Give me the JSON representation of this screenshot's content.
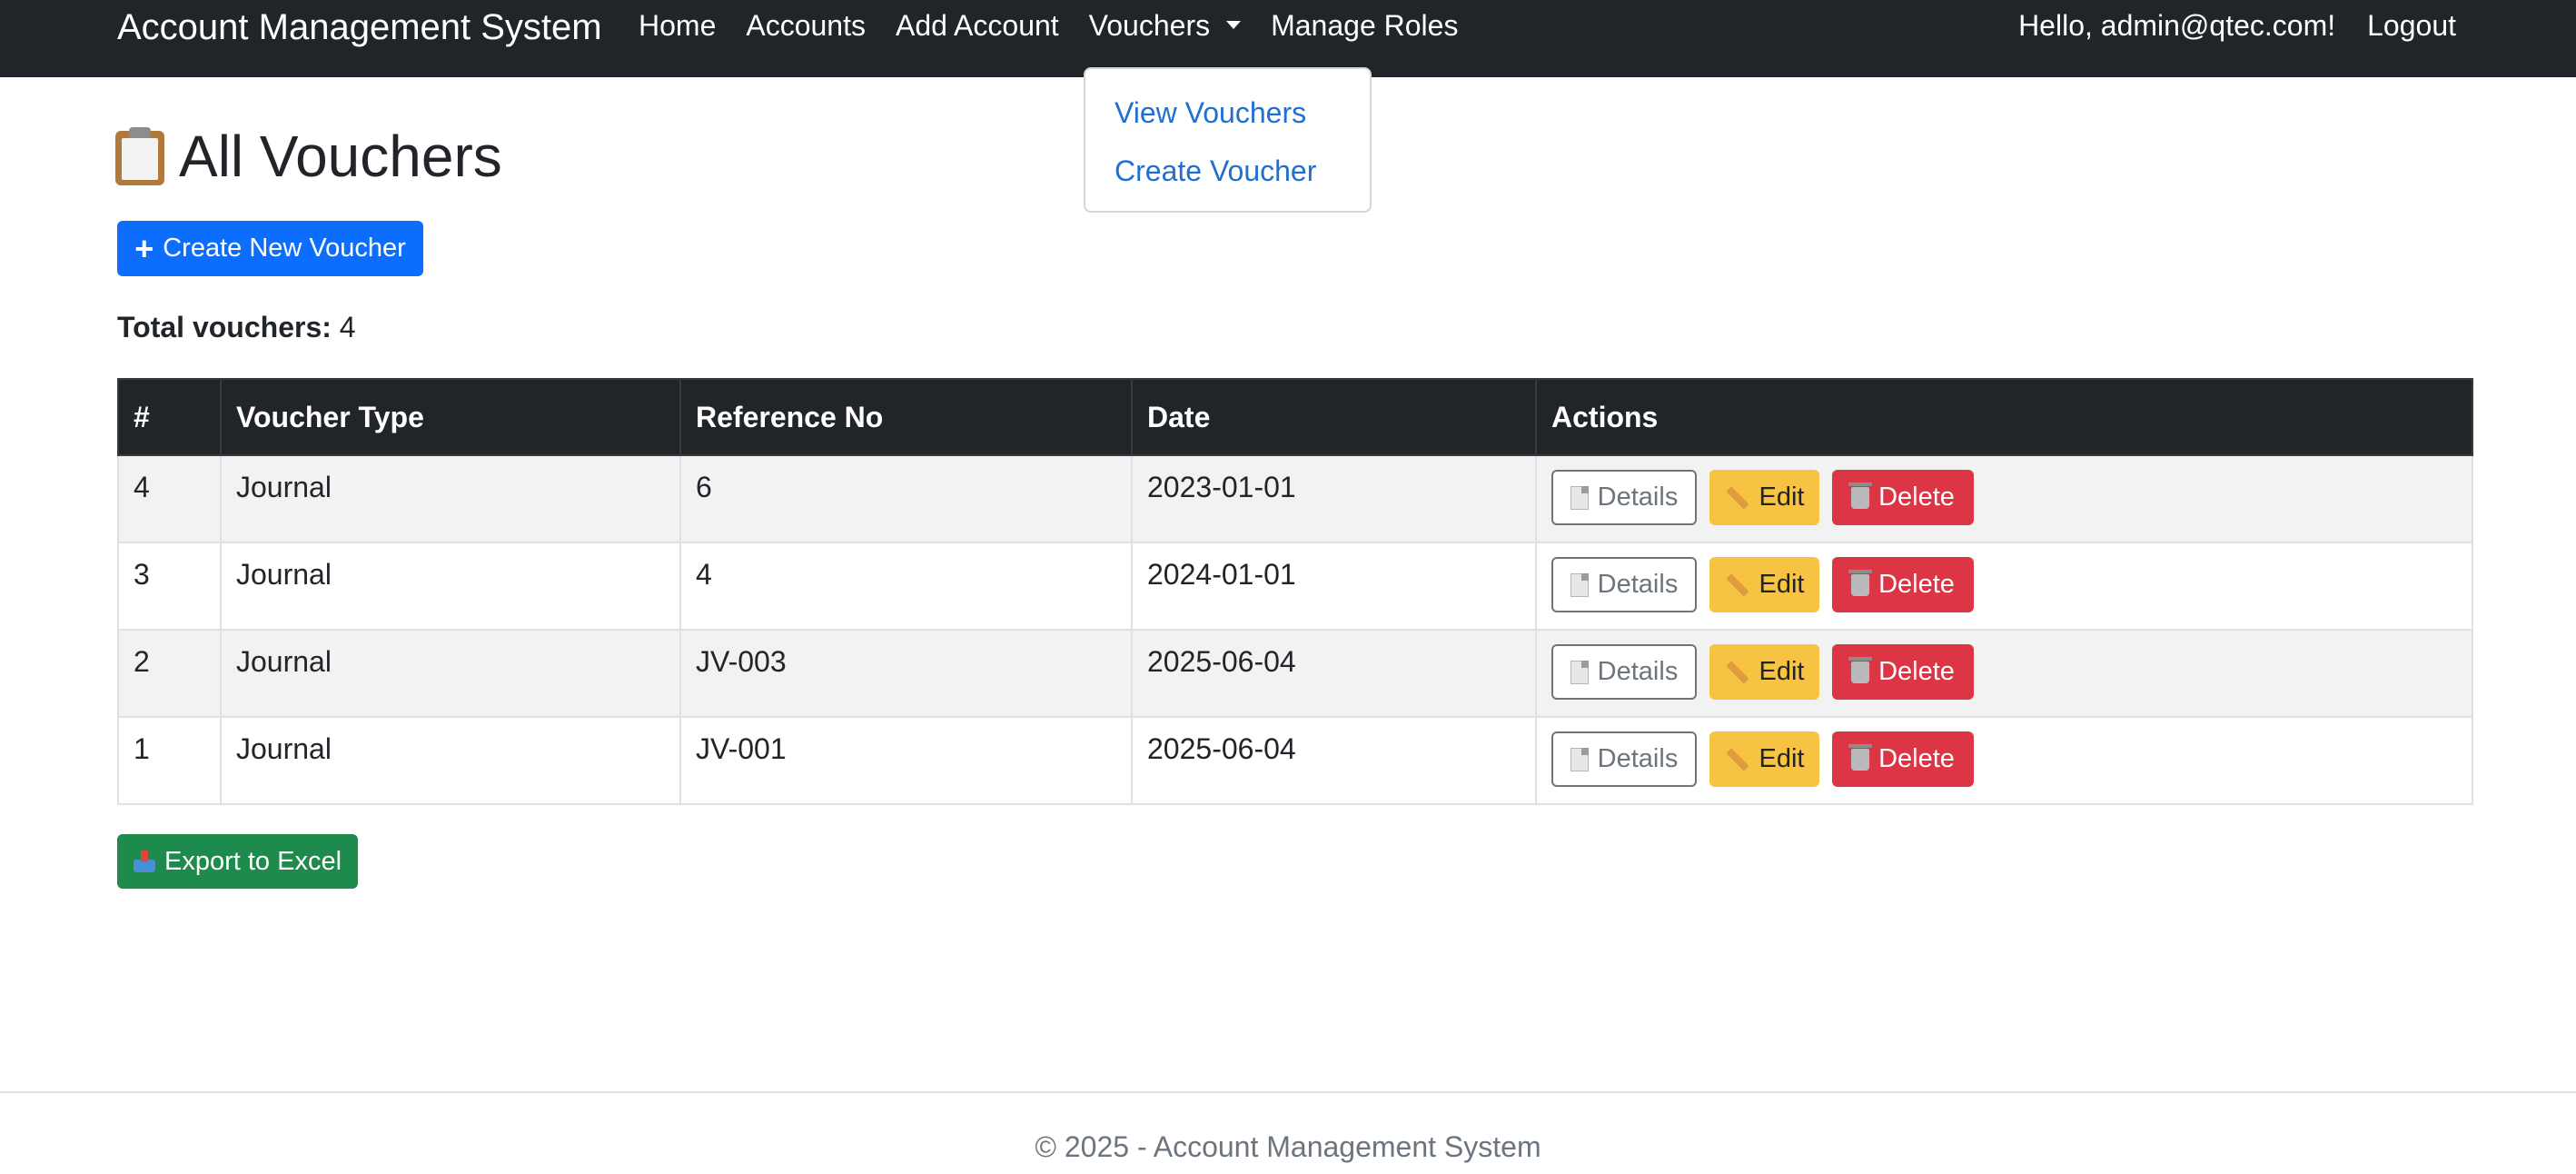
{
  "navbar": {
    "brand": "Account Management System",
    "links": [
      "Home",
      "Accounts",
      "Add Account",
      "Vouchers",
      "Manage Roles"
    ],
    "greeting": "Hello, admin@qtec.com!",
    "logout": "Logout"
  },
  "dropdown": {
    "items": [
      "View Vouchers",
      "Create Voucher"
    ]
  },
  "page": {
    "title": "All Vouchers",
    "create_button": "Create New Voucher",
    "total_label": "Total vouchers:",
    "total_value": "4",
    "export_button": "Export to Excel"
  },
  "table": {
    "headers": [
      "#",
      "Voucher Type",
      "Reference No",
      "Date",
      "Actions"
    ],
    "rows": [
      {
        "id": "4",
        "type": "Journal",
        "ref": "6",
        "date": "2023-01-01"
      },
      {
        "id": "3",
        "type": "Journal",
        "ref": "4",
        "date": "2024-01-01"
      },
      {
        "id": "2",
        "type": "Journal",
        "ref": "JV-003",
        "date": "2025-06-04"
      },
      {
        "id": "1",
        "type": "Journal",
        "ref": "JV-001",
        "date": "2025-06-04"
      }
    ],
    "actions": {
      "details": "Details",
      "edit": "Edit",
      "delete": "Delete"
    }
  },
  "footer": {
    "text": "© 2025 - Account Management System"
  },
  "icons": [
    "clipboard-icon",
    "plus-icon",
    "caret-icon",
    "doc-icon",
    "pencil-icon",
    "trash-icon",
    "outbox-icon"
  ],
  "colors": {
    "navbar": "#212529",
    "primary": "#0d6efd",
    "warning": "#ffc107",
    "danger": "#dc3545",
    "success": "#198754",
    "secondary": "#6c757d"
  }
}
